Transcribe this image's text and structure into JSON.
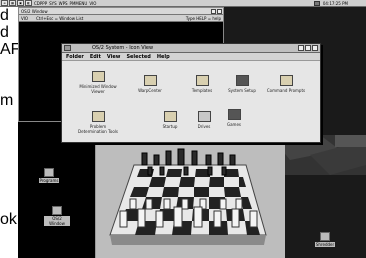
{
  "topbar": {
    "items": [
      "CDPPP",
      "SYS",
      "WPS",
      "PMMENU",
      "VIO"
    ],
    "clock": "04:17:25 PM"
  },
  "left_strip": {
    "lines": [
      "d",
      "d",
      "AF",
      "",
      "",
      "m",
      "",
      "",
      "",
      "",
      "",
      "",
      "ok"
    ]
  },
  "vio_window": {
    "title": "OS/2 Window",
    "status_left": "VIO",
    "status_mid": "Ctrl+Esc = Window List",
    "status_right": "Type HELP = help"
  },
  "os2_window": {
    "title": "OS/2 System - Icon View",
    "menu": [
      "Folder",
      "Edit",
      "View",
      "Selected",
      "Help"
    ],
    "objects": [
      {
        "label": "Minimized Window Viewer",
        "icon": "window-icon"
      },
      {
        "label": "WarpCenter",
        "icon": "folder-icon"
      },
      {
        "label": "Templates",
        "icon": "folder-icon"
      },
      {
        "label": "System Setup",
        "icon": "setup-icon"
      },
      {
        "label": "Command Prompts",
        "icon": "folder-icon"
      },
      {
        "label": "Problem Determination Tools",
        "icon": "folder-icon"
      },
      {
        "label": "Startup",
        "icon": "folder-icon"
      },
      {
        "label": "Drives",
        "icon": "drives-icon"
      },
      {
        "label": "Games",
        "icon": "games-icon"
      }
    ]
  },
  "desktop_icons": [
    {
      "label": "Programs",
      "icon": "programs-icon"
    },
    {
      "label": "OS/2 Window",
      "icon": "os2-window-icon"
    },
    {
      "label": "Shredder",
      "icon": "shredder-icon"
    }
  ]
}
